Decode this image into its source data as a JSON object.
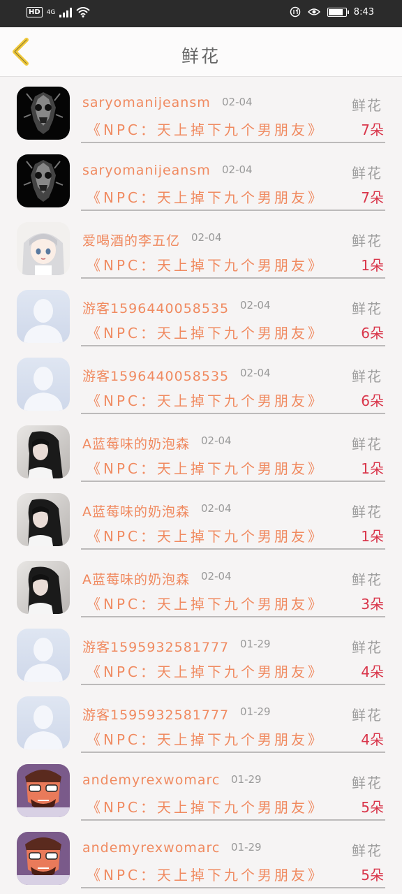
{
  "status_bar": {
    "hd": "HD",
    "network": "4G",
    "time": "8:43",
    "battery_level": 0.85
  },
  "header": {
    "title": "鲜花",
    "back_icon": "chevron-left-icon",
    "accent": "#f0c93a"
  },
  "colors": {
    "username": "#f08a60",
    "count": "#d9354a",
    "type": "#9d9d9d",
    "date": "#9a9a9a"
  },
  "gifts": [
    {
      "avatar": "skull-avatar",
      "username": "saryomanijeansm",
      "date": "02-04",
      "type": "鲜花",
      "book": "《NPC：天上掉下九个男朋友》",
      "count": "7朵"
    },
    {
      "avatar": "skull-avatar",
      "username": "saryomanijeansm",
      "date": "02-04",
      "type": "鲜花",
      "book": "《NPC：天上掉下九个男朋友》",
      "count": "7朵"
    },
    {
      "avatar": "anime-girl-avatar",
      "username": "爱喝酒的李五亿",
      "date": "02-04",
      "type": "鲜花",
      "book": "《NPC：天上掉下九个男朋友》",
      "count": "1朵"
    },
    {
      "avatar": "default-user-avatar",
      "username": "游客1596440058535",
      "date": "02-04",
      "type": "鲜花",
      "book": "《NPC：天上掉下九个男朋友》",
      "count": "6朵"
    },
    {
      "avatar": "default-user-avatar",
      "username": "游客1596440058535",
      "date": "02-04",
      "type": "鲜花",
      "book": "《NPC：天上掉下九个男朋友》",
      "count": "6朵"
    },
    {
      "avatar": "photo-girl-avatar",
      "username": "A蓝莓味的奶泡森",
      "date": "02-04",
      "type": "鲜花",
      "book": "《NPC：天上掉下九个男朋友》",
      "count": "1朵"
    },
    {
      "avatar": "photo-girl-avatar",
      "username": "A蓝莓味的奶泡森",
      "date": "02-04",
      "type": "鲜花",
      "book": "《NPC：天上掉下九个男朋友》",
      "count": "1朵"
    },
    {
      "avatar": "photo-girl-avatar",
      "username": "A蓝莓味的奶泡森",
      "date": "02-04",
      "type": "鲜花",
      "book": "《NPC：天上掉下九个男朋友》",
      "count": "3朵"
    },
    {
      "avatar": "default-user-avatar",
      "username": "游客1595932581777",
      "date": "01-29",
      "type": "鲜花",
      "book": "《NPC：天上掉下九个男朋友》",
      "count": "4朵"
    },
    {
      "avatar": "default-user-avatar",
      "username": "游客1595932581777",
      "date": "01-29",
      "type": "鲜花",
      "book": "《NPC：天上掉下九个男朋友》",
      "count": "4朵"
    },
    {
      "avatar": "cartoon-man-avatar",
      "username": "andemyrexwomarc",
      "date": "01-29",
      "type": "鲜花",
      "book": "《NPC：天上掉下九个男朋友》",
      "count": "5朵"
    },
    {
      "avatar": "cartoon-man-avatar",
      "username": "andemyrexwomarc",
      "date": "01-29",
      "type": "鲜花",
      "book": "《NPC：天上掉下九个男朋友》",
      "count": "5朵"
    }
  ]
}
